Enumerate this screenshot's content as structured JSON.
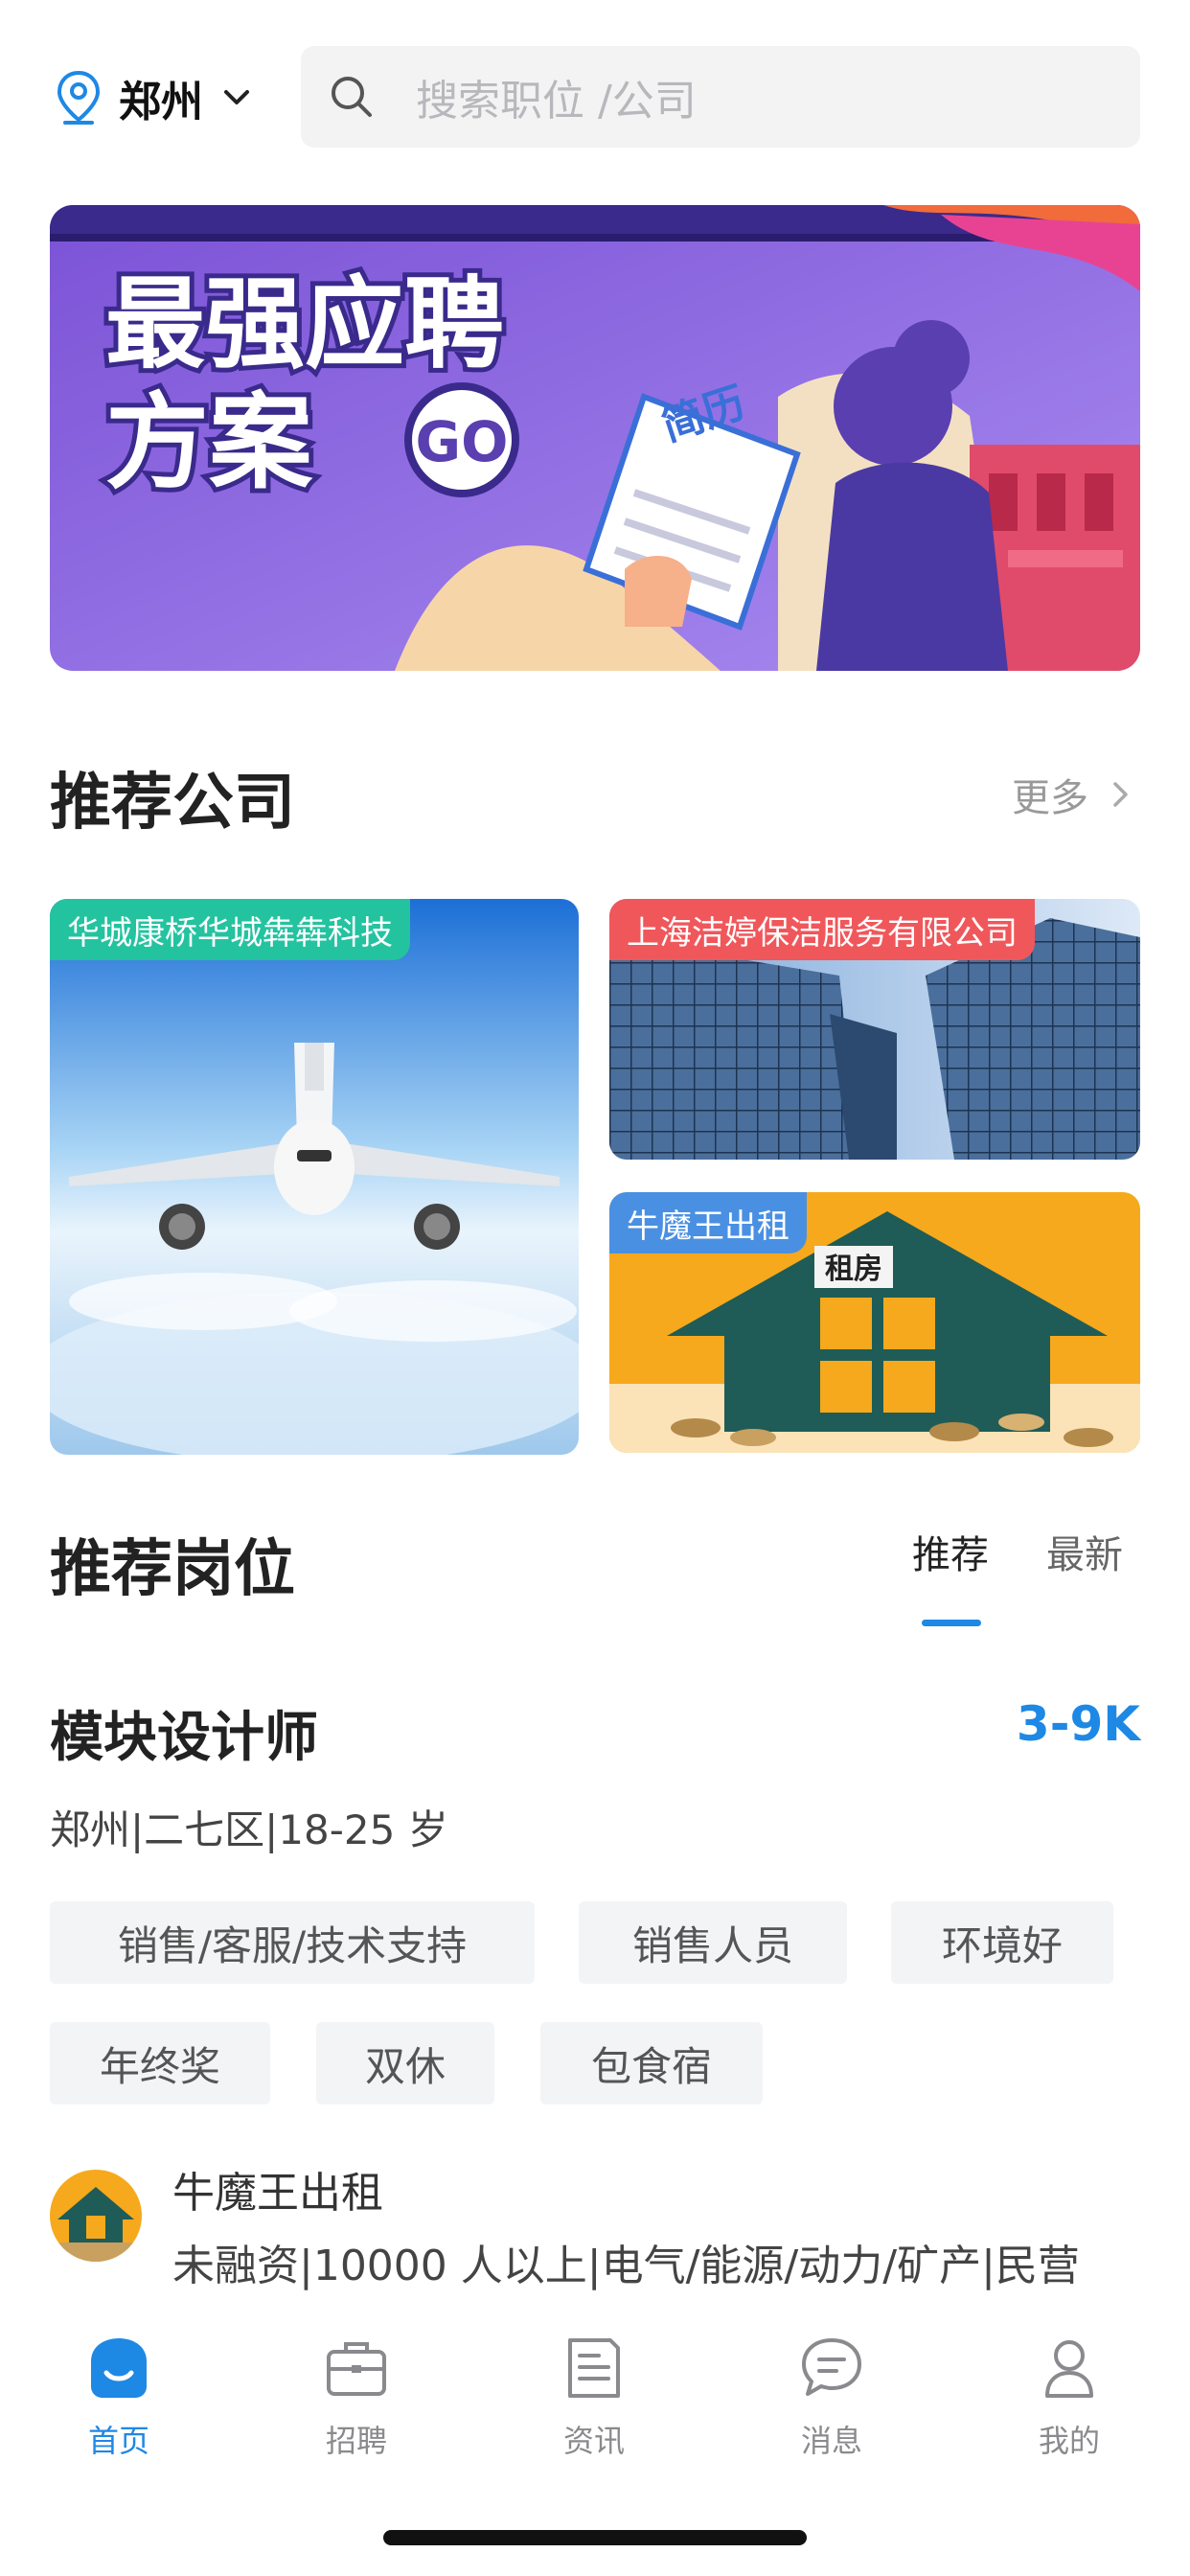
{
  "header": {
    "city": "郑州",
    "search_placeholder": "搜索职位 /公司"
  },
  "banner": {
    "headline_line1": "最强应聘",
    "headline_line2": "方案",
    "go": "GO",
    "document_label": "简历"
  },
  "recommended_companies": {
    "title": "推荐公司",
    "more": "更多",
    "cards": [
      {
        "name": "华城康桥华城犇犇科技",
        "tag_color": "#23c3a0"
      },
      {
        "name": "上海洁婷保洁服务有限公司",
        "tag_color": "#f0575b"
      },
      {
        "name": "牛魔王出租",
        "tag_color": "#4a90e2",
        "sign": "租房"
      }
    ]
  },
  "recommended_jobs": {
    "title": "推荐岗位",
    "tabs": [
      {
        "label": "推荐",
        "active": true
      },
      {
        "label": "最新",
        "active": false
      }
    ],
    "job": {
      "title": "模块设计师",
      "salary": "3-9K",
      "meta": "郑州|二七区|18-25 岁",
      "tags": [
        "销售/客服/技术支持",
        "销售人员",
        "环境好",
        "年终奖",
        "双休",
        "包食宿"
      ],
      "company_name": "牛魔王出租",
      "company_info": "未融资|10000 人以上|电气/能源/动力/矿产|民营"
    }
  },
  "bottom_nav": [
    {
      "label": "首页",
      "icon": "home-icon",
      "active": true
    },
    {
      "label": "招聘",
      "icon": "briefcase-icon",
      "active": false
    },
    {
      "label": "资讯",
      "icon": "news-icon",
      "active": false
    },
    {
      "label": "消息",
      "icon": "message-icon",
      "active": false
    },
    {
      "label": "我的",
      "icon": "profile-icon",
      "active": false
    }
  ],
  "colors": {
    "accent": "#1e88e5",
    "tag_bg": "#f3f4f6"
  }
}
